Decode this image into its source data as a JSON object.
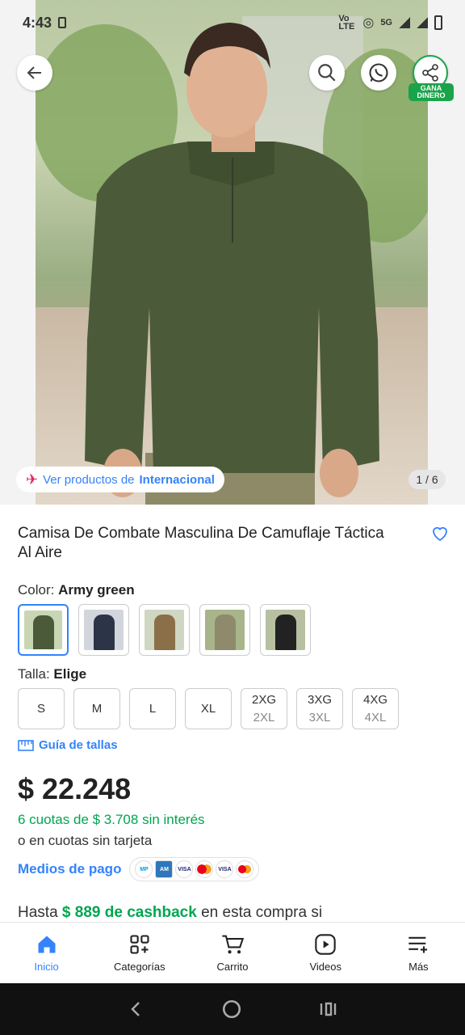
{
  "status_bar": {
    "time": "4:43",
    "indicators": [
      "Vo LTE",
      "5G"
    ],
    "icons": [
      "sim-icon",
      "hotspot-icon",
      "signal-icon",
      "battery-icon"
    ]
  },
  "hero": {
    "pager": "1 / 6",
    "intl_prefix": "Ver productos de",
    "intl_link": "Internacional",
    "share_badge": "GANA DINERO"
  },
  "product": {
    "title": "Camisa De Combate Masculina De Camuflaje Táctica Al Aire",
    "color_label": "Color:",
    "color_value": "Army green",
    "swatch_colors": [
      "#4b5b39",
      "#2c3447",
      "#8a6f48",
      "#8f8a6b",
      "#222222"
    ],
    "size_label": "Talla:",
    "size_value": "Elige",
    "sizes": [
      {
        "main": "S",
        "alt": ""
      },
      {
        "main": "M",
        "alt": ""
      },
      {
        "main": "L",
        "alt": ""
      },
      {
        "main": "XL",
        "alt": ""
      },
      {
        "main": "2XG",
        "alt": "2XL"
      },
      {
        "main": "3XG",
        "alt": "3XL"
      },
      {
        "main": "4XG",
        "alt": "4XL"
      }
    ],
    "size_guide": "Guía de tallas",
    "price": "$ 22.248",
    "installments": "6 cuotas de $ 3.708 sin interés",
    "no_card": "o en cuotas sin tarjeta",
    "payment_methods_label": "Medios de pago",
    "payment_icons": [
      "mercadopago-icon",
      "amex-icon",
      "visa-icon",
      "mastercard-icon",
      "visa-debit-icon",
      "mastercard-debit-icon"
    ],
    "cashback_prefix": "Hasta",
    "cashback_amount": "$ 889 de cashback",
    "cashback_suffix": "en esta compra si"
  },
  "tabbar": {
    "items": [
      {
        "label": "Inicio",
        "icon": "home-icon"
      },
      {
        "label": "Categorías",
        "icon": "categories-icon"
      },
      {
        "label": "Carrito",
        "icon": "cart-icon"
      },
      {
        "label": "Videos",
        "icon": "video-icon"
      },
      {
        "label": "Más",
        "icon": "menu-more-icon"
      }
    ]
  },
  "colors": {
    "accent": "#3483fa",
    "green": "#00a650"
  }
}
